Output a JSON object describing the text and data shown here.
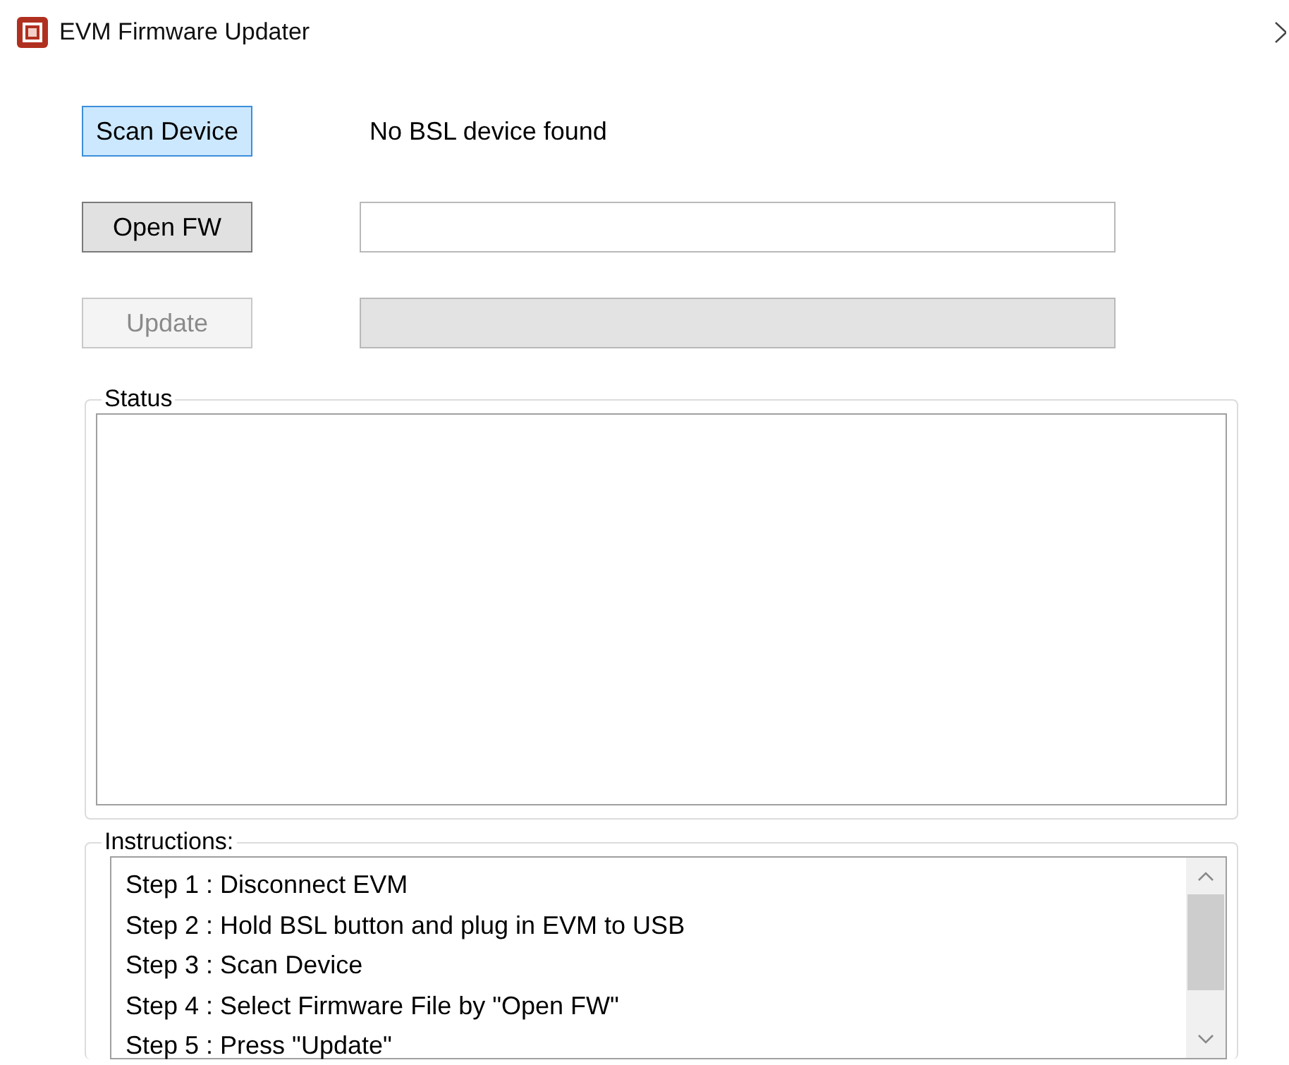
{
  "window": {
    "title": "EVM Firmware Updater"
  },
  "rows": [
    {
      "button": {
        "label": "Scan Device",
        "focused": true,
        "disabled": false
      },
      "message": "No BSL device found"
    },
    {
      "button": {
        "label": "Open FW",
        "focused": false,
        "disabled": false
      },
      "field": {
        "disabled": false
      }
    },
    {
      "button": {
        "label": "Update",
        "focused": false,
        "disabled": true
      },
      "field": {
        "disabled": true
      }
    }
  ],
  "status": {
    "title": "Status"
  },
  "instructions": {
    "title": "Instructions:",
    "items": [
      "Step 1 : Disconnect EVM",
      "Step 2 : Hold BSL button and plug in EVM to USB",
      "Step 3 : Scan Device",
      "Step 4 : Select Firmware File by \"Open FW\"",
      "Step 5 : Press \"Update\""
    ]
  }
}
